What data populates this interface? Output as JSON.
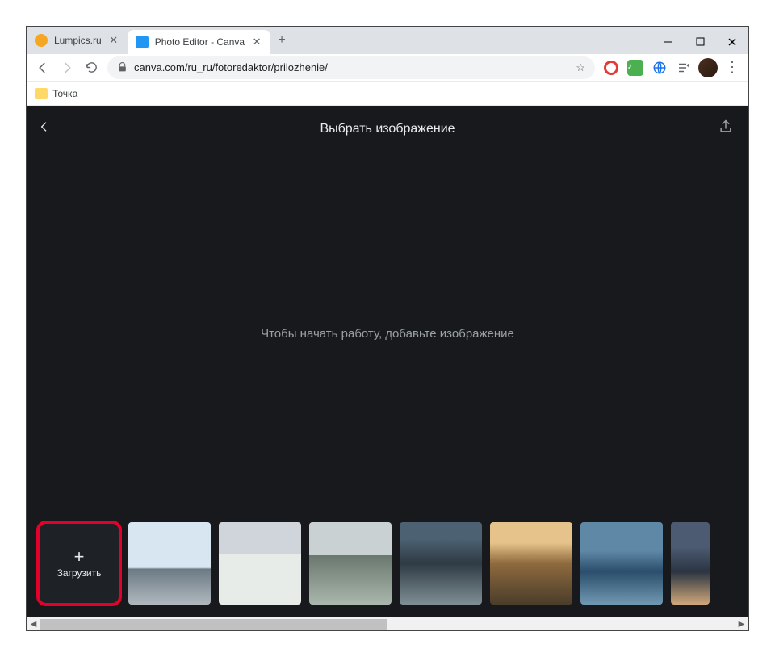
{
  "titlebar": {
    "tabs": [
      {
        "title": "Lumpics.ru",
        "favicon_color": "#f5a623"
      },
      {
        "title": "Photo Editor - Canva",
        "favicon_color": "#2196f3"
      }
    ]
  },
  "addressbar": {
    "url": "canva.com/ru_ru/fotoredaktor/prilozhenie/"
  },
  "bookmarkbar": {
    "items": [
      {
        "label": "Точка"
      }
    ]
  },
  "app": {
    "page_title": "Выбрать изображение",
    "placeholder_text": "Чтобы начать работу, добавьте изображение",
    "upload_label": "Загрузить"
  },
  "thumbnails": [
    {
      "name": "sample-beach"
    },
    {
      "name": "sample-city-clouds"
    },
    {
      "name": "sample-field"
    },
    {
      "name": "sample-mountain-lake"
    },
    {
      "name": "sample-desert-road"
    },
    {
      "name": "sample-surf"
    },
    {
      "name": "sample-portrait"
    }
  ]
}
